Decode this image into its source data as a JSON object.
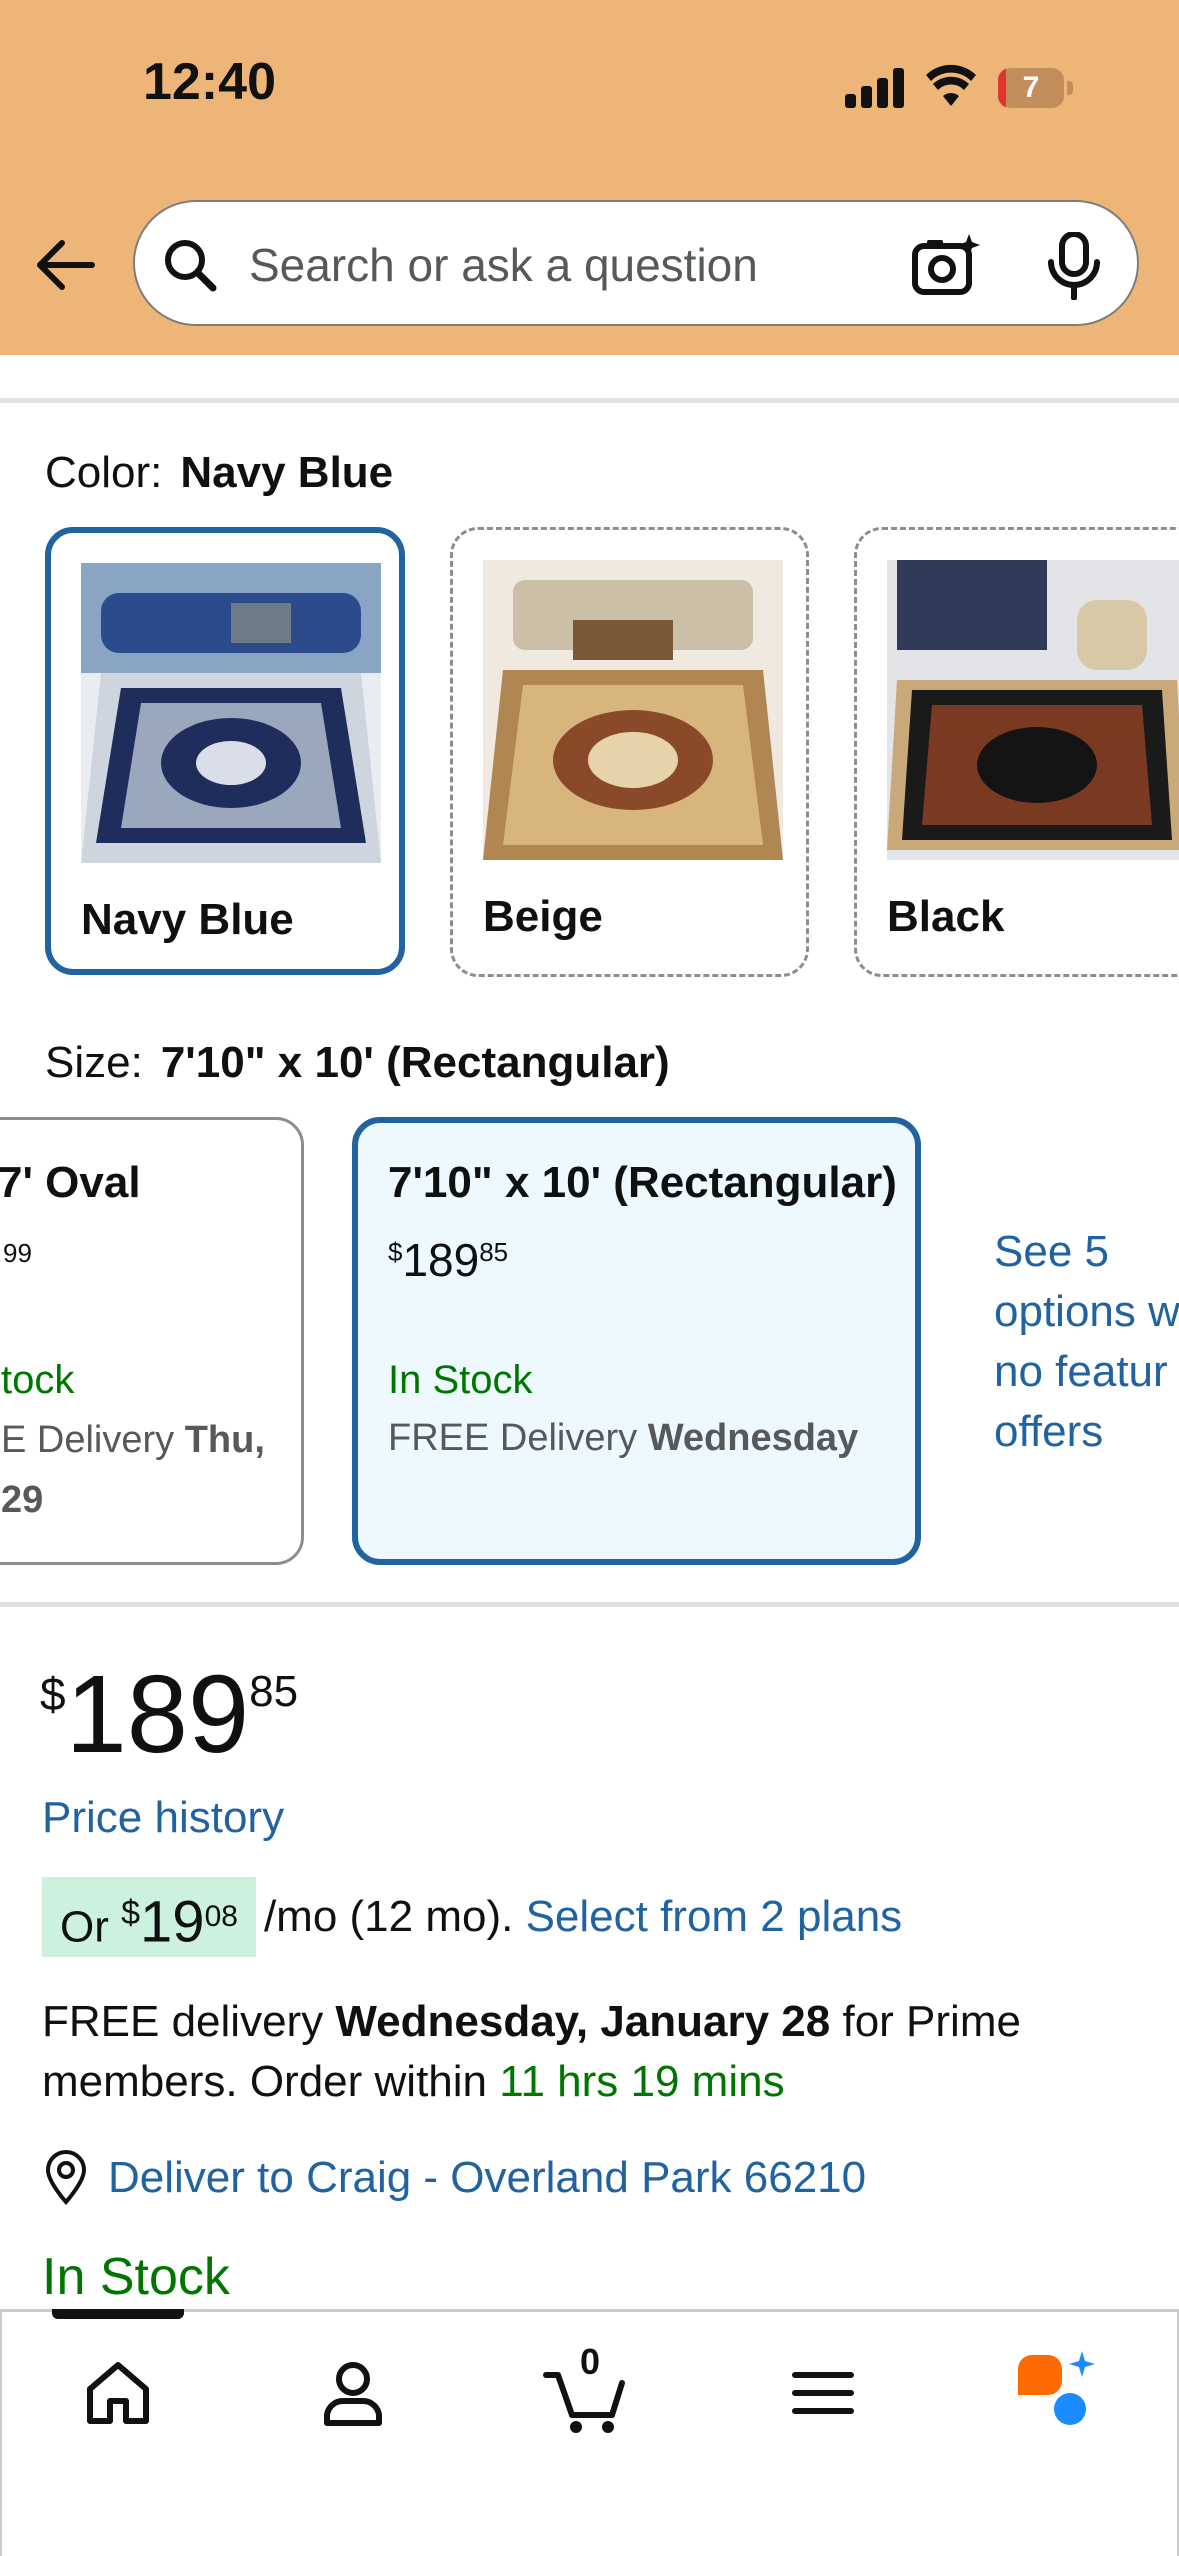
{
  "status_bar": {
    "time": "12:40",
    "battery": "7"
  },
  "search": {
    "placeholder": "Search or ask a question"
  },
  "color_section": {
    "label": "Color:",
    "selected": "Navy Blue",
    "options": [
      {
        "name": "Navy Blue",
        "selected": true
      },
      {
        "name": "Beige",
        "selected": false
      },
      {
        "name": "Black",
        "selected": false
      }
    ]
  },
  "size_section": {
    "label": "Size:",
    "selected": "7'10\" x 10' (Rectangular)",
    "options": [
      {
        "title": "7' Oval",
        "price_fraction": "99",
        "stock": "tock",
        "delivery_prefix": "E Delivery",
        "delivery_day": "Thu,",
        "delivery_day2": "29"
      },
      {
        "title": "7'10\" x 10' (Rectangular)",
        "price_symbol": "$",
        "price_whole": "189",
        "price_fraction": "85",
        "stock": "In Stock",
        "delivery_prefix": "FREE Delivery",
        "delivery_day": "Wednesday"
      }
    ],
    "see_options": [
      "See 5",
      "options w",
      "no featur",
      "offers"
    ]
  },
  "price": {
    "symbol": "$",
    "whole": "189",
    "fraction": "85",
    "price_history": "Price history",
    "installment_prefix": "Or",
    "installment_symbol": "$",
    "installment_whole": "19",
    "installment_fraction": "08",
    "installment_suffix": "/mo (12 mo).",
    "installment_link": "Select from 2 plans"
  },
  "delivery": {
    "prefix": "FREE delivery",
    "date": "Wednesday, January 28",
    "suffix": "for Prime members. Order within",
    "countdown": "11 hrs 19 mins",
    "deliver_to": "Deliver to Craig - Overland Park 66210",
    "stock": "In Stock"
  },
  "tabbar": {
    "cart_count": "0",
    "tabs": [
      "home-icon",
      "account-icon",
      "cart-icon",
      "menu-icon",
      "rufus-icon"
    ]
  },
  "colors": {
    "header_bg": "#edb678",
    "link_blue": "#2162a1",
    "stock_green": "#007600",
    "selected_border": "#2162a1",
    "selected_bg": "#edf8ff",
    "installment_bg": "#cdf1df"
  }
}
